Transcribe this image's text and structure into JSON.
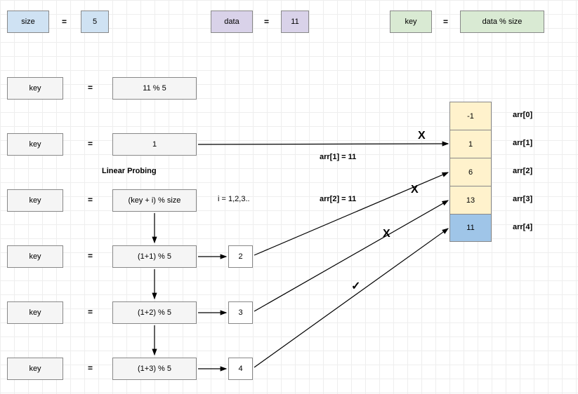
{
  "header": {
    "size": {
      "label": "size",
      "eq": "=",
      "value": "5"
    },
    "data": {
      "label": "data",
      "eq": "=",
      "value": "11"
    },
    "key": {
      "label": "key",
      "eq": "=",
      "value": "data % size"
    }
  },
  "rows": [
    {
      "label": "key",
      "eq": "=",
      "expr": "11 % 5"
    },
    {
      "label": "key",
      "eq": "=",
      "expr": "1"
    },
    {
      "label": "key",
      "eq": "=",
      "expr": "(key + i) % size",
      "note": "i = 1,2,3.."
    },
    {
      "label": "key",
      "eq": "=",
      "expr": "(1+1) % 5",
      "result": "2"
    },
    {
      "label": "key",
      "eq": "=",
      "expr": "(1+2) % 5",
      "result": "3"
    },
    {
      "label": "key",
      "eq": "=",
      "expr": "(1+3) % 5",
      "result": "4"
    }
  ],
  "sectionTitle": "Linear Probing",
  "array": {
    "cells": [
      "-1",
      "1",
      "6",
      "13",
      "11"
    ],
    "labels": [
      "arr[0]",
      "arr[1]",
      "arr[2]",
      "arr[3]",
      "arr[4]"
    ]
  },
  "annotations": {
    "a1": "arr[1] = 11",
    "a2": "arr[2] = 11"
  },
  "marks": {
    "x": "X",
    "check": "✓"
  }
}
